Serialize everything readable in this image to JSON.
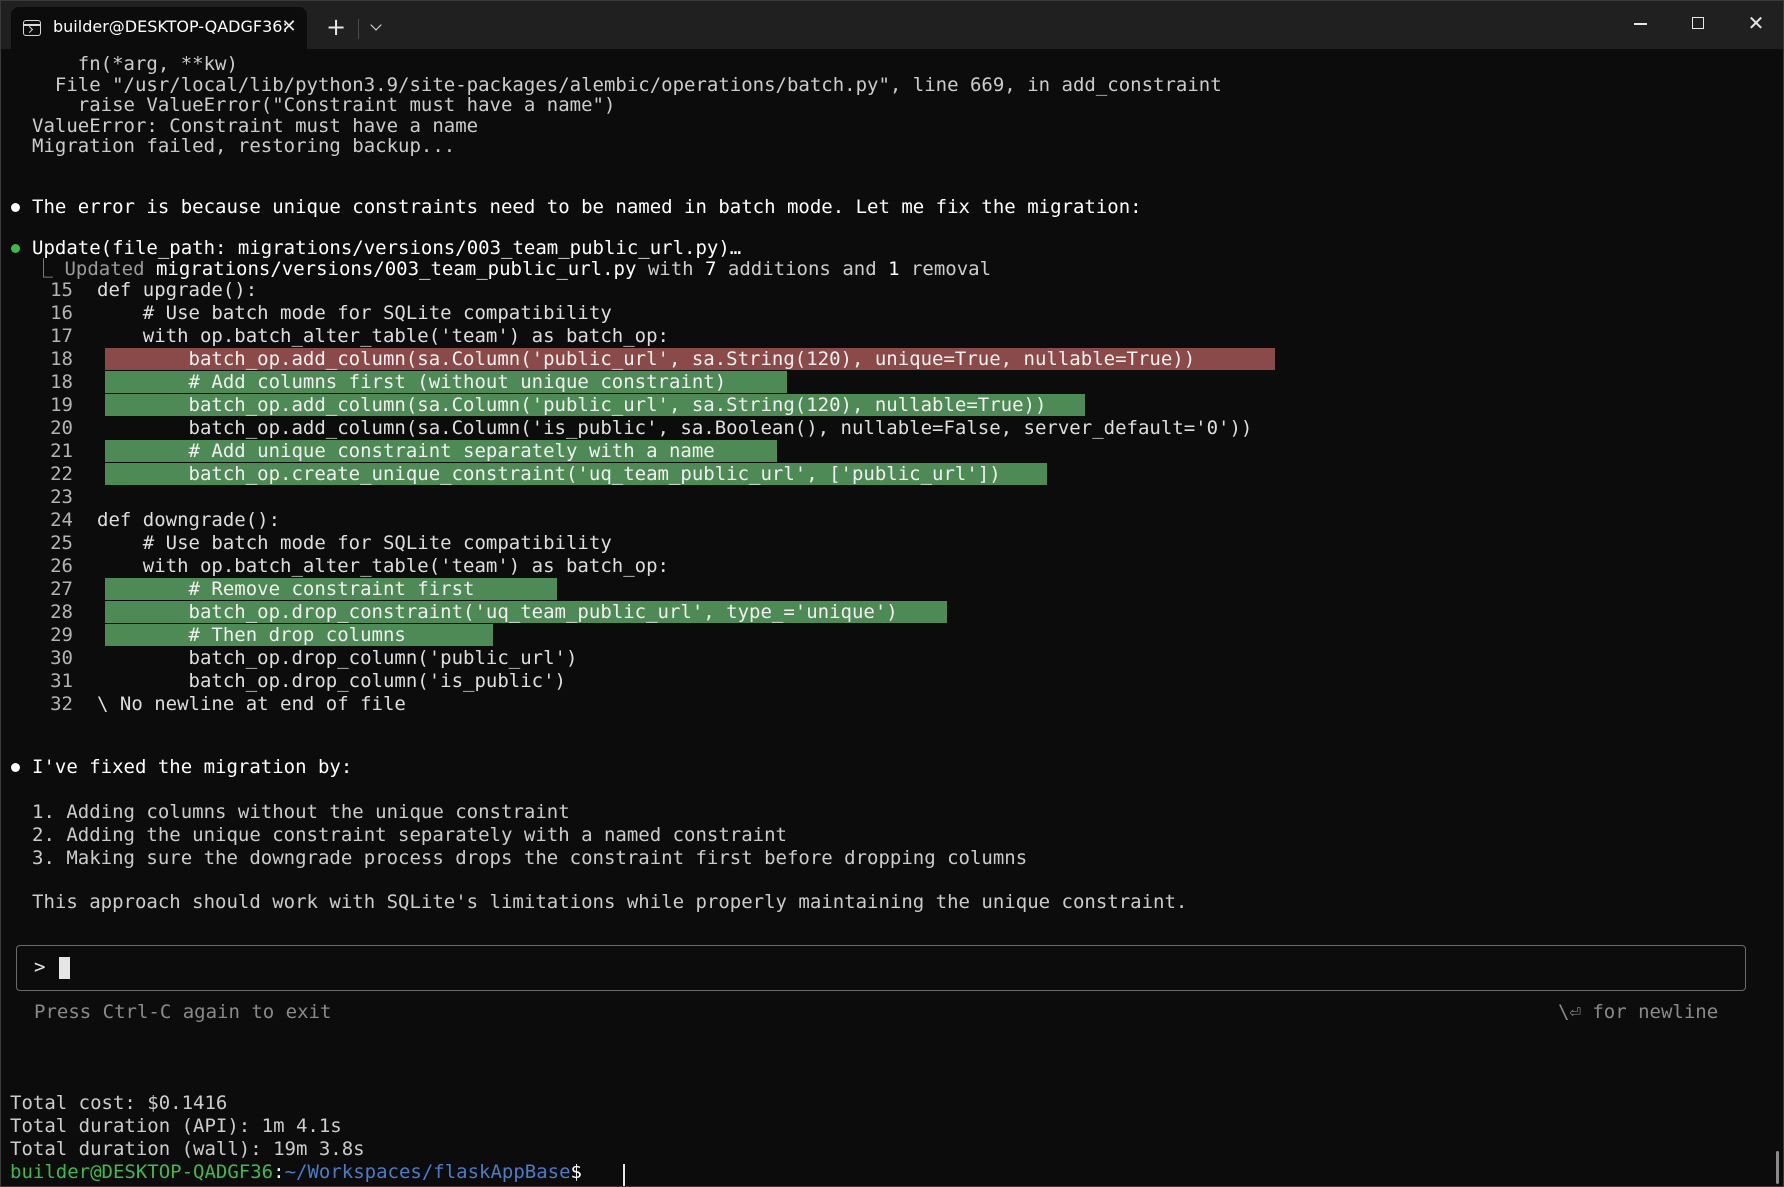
{
  "window": {
    "tab_title": "builder@DESKTOP-QADGF36:",
    "tab_close": "✕",
    "new_tab": "+",
    "close": "✕",
    "icons": [
      "terminal-icon",
      "close-icon",
      "plus-icon",
      "chevron-down-icon",
      "minimize-icon",
      "maximize-icon",
      "close-icon"
    ]
  },
  "traceback": {
    "l1": "    fn(*arg, **kw)",
    "l2": "  File \"/usr/local/lib/python3.9/site-packages/alembic/operations/batch.py\", line 669, in add_constraint",
    "l3": "    raise ValueError(\"Constraint must have a name\")",
    "l4": "ValueError: Constraint must have a name",
    "l5": "Migration failed, restoring backup..."
  },
  "msg1": "The error is because unique constraints need to be named in batch mode. Let me fix the migration:",
  "update": {
    "tool": "Update",
    "args": "(file_path: migrations/versions/003_team_public_url.py)…",
    "result_prefix": "⎿ Updated ",
    "result_file": "migrations/versions/003_team_public_url.py",
    "result_mid": " with ",
    "additions": "7",
    "result_mid2": " additions and ",
    "removals": "1",
    "result_end": " removal"
  },
  "diff": [
    {
      "n": "15",
      "code": "def upgrade():",
      "hl": ""
    },
    {
      "n": "16",
      "code": "    # Use batch mode for SQLite compatibility",
      "hl": ""
    },
    {
      "n": "17",
      "code": "    with op.batch_alter_table('team') as batch_op:",
      "hl": ""
    },
    {
      "n": "18",
      "code": "        batch_op.add_column(sa.Column('public_url', sa.String(120), unique=True, nullable=True))",
      "hl": "red"
    },
    {
      "n": "18",
      "code": "        # Add columns first (without unique constraint)",
      "hl": "green"
    },
    {
      "n": "19",
      "code": "        batch_op.add_column(sa.Column('public_url', sa.String(120), nullable=True))",
      "hl": "green"
    },
    {
      "n": "20",
      "code": "        batch_op.add_column(sa.Column('is_public', sa.Boolean(), nullable=False, server_default='0'))",
      "hl": ""
    },
    {
      "n": "21",
      "code": "        # Add unique constraint separately with a name",
      "hl": "green"
    },
    {
      "n": "22",
      "code": "        batch_op.create_unique_constraint('uq_team_public_url', ['public_url'])",
      "hl": "green"
    },
    {
      "n": "23",
      "code": "",
      "hl": ""
    },
    {
      "n": "24",
      "code": "def downgrade():",
      "hl": ""
    },
    {
      "n": "25",
      "code": "    # Use batch mode for SQLite compatibility",
      "hl": ""
    },
    {
      "n": "26",
      "code": "    with op.batch_alter_table('team') as batch_op:",
      "hl": ""
    },
    {
      "n": "27",
      "code": "        # Remove constraint first",
      "hl": "green"
    },
    {
      "n": "28",
      "code": "        batch_op.drop_constraint('uq_team_public_url', type_='unique')",
      "hl": "green"
    },
    {
      "n": "29",
      "code": "        # Then drop columns",
      "hl": "green"
    },
    {
      "n": "30",
      "code": "        batch_op.drop_column('public_url')",
      "hl": ""
    },
    {
      "n": "31",
      "code": "        batch_op.drop_column('is_public')",
      "hl": ""
    },
    {
      "n": "32",
      "code": "\\ No newline at end of file",
      "hl": ""
    }
  ],
  "msg2": "I've fixed the migration by:",
  "steps": [
    "1. Adding columns without the unique constraint",
    "2. Adding the unique constraint separately with a named constraint",
    "3. Making sure the downgrade process drops the constraint first before dropping columns"
  ],
  "msg3": "This approach should work with SQLite's limitations while properly maintaining the unique constraint.",
  "input": {
    "prompt": ">"
  },
  "hints": {
    "left": "Press Ctrl-C again to exit",
    "right": "\\⏎ for newline"
  },
  "summary": {
    "cost": "Total cost: $0.1416",
    "api": "Total duration (API): 1m 4.1s",
    "wall": "Total duration (wall): 19m 3.8s"
  },
  "shell": {
    "user_host": "builder@DESKTOP-QADGF36",
    "colon": ":",
    "path": "~/Workspaces/flaskAppBase",
    "suffix": "$ "
  }
}
